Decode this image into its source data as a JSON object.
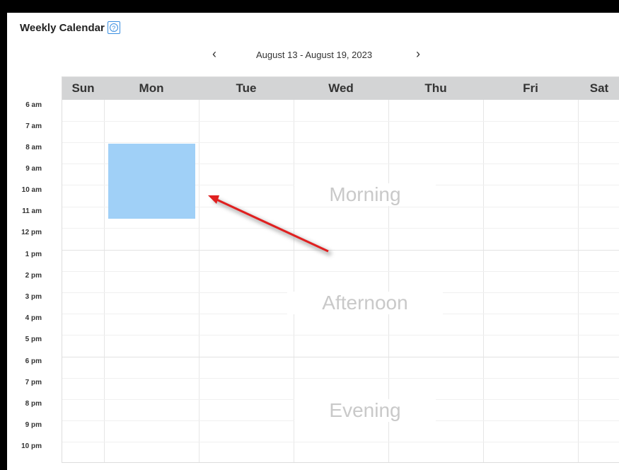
{
  "title": "Weekly Calendar",
  "help_icon": "question-circle-icon",
  "nav": {
    "prev": "‹",
    "range": "August 13 - August 19, 2023",
    "next": "›"
  },
  "days": [
    "Sun",
    "Mon",
    "Tue",
    "Wed",
    "Thu",
    "Fri",
    "Sat"
  ],
  "hours": [
    "6 am",
    "7 am",
    "8 am",
    "9 am",
    "10 am",
    "11 am",
    "12 pm",
    "1 pm",
    "2 pm",
    "3 pm",
    "4 pm",
    "5 pm",
    "6 pm",
    "7 pm",
    "8 pm",
    "9 pm",
    "10 pm"
  ],
  "sections": {
    "morning": "Morning",
    "afternoon": "Afternoon",
    "evening": "Evening"
  },
  "event": {
    "day": "Mon",
    "start": "8 am",
    "end": "11 am",
    "color": "#a0d0f7"
  },
  "annotation": {
    "type": "arrow",
    "color": "#e02020"
  }
}
